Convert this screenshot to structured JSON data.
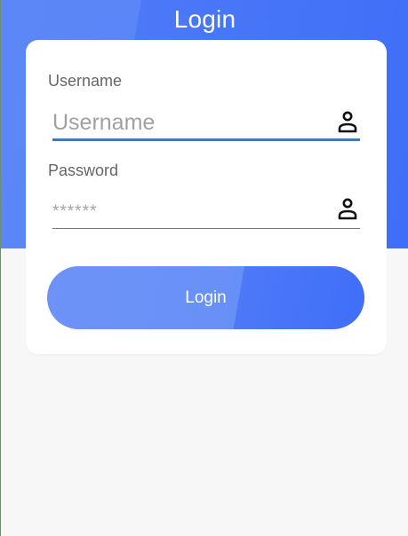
{
  "header": {
    "title": "Login"
  },
  "form": {
    "username": {
      "label": "Username",
      "placeholder": "Username",
      "value": "",
      "icon": "user-icon"
    },
    "password": {
      "label": "Password",
      "placeholder": "******",
      "value": "",
      "icon": "user-icon"
    },
    "submit_label": "Login"
  },
  "colors": {
    "header_start": "#5c87f6",
    "header_end": "#3f6ef8",
    "button_start": "#6e93f7",
    "button_end": "#3f6ef8",
    "username_underline": "#4579b8",
    "password_underline": "#777777",
    "page_background": "#f7f7f7",
    "card_background": "#ffffff"
  }
}
